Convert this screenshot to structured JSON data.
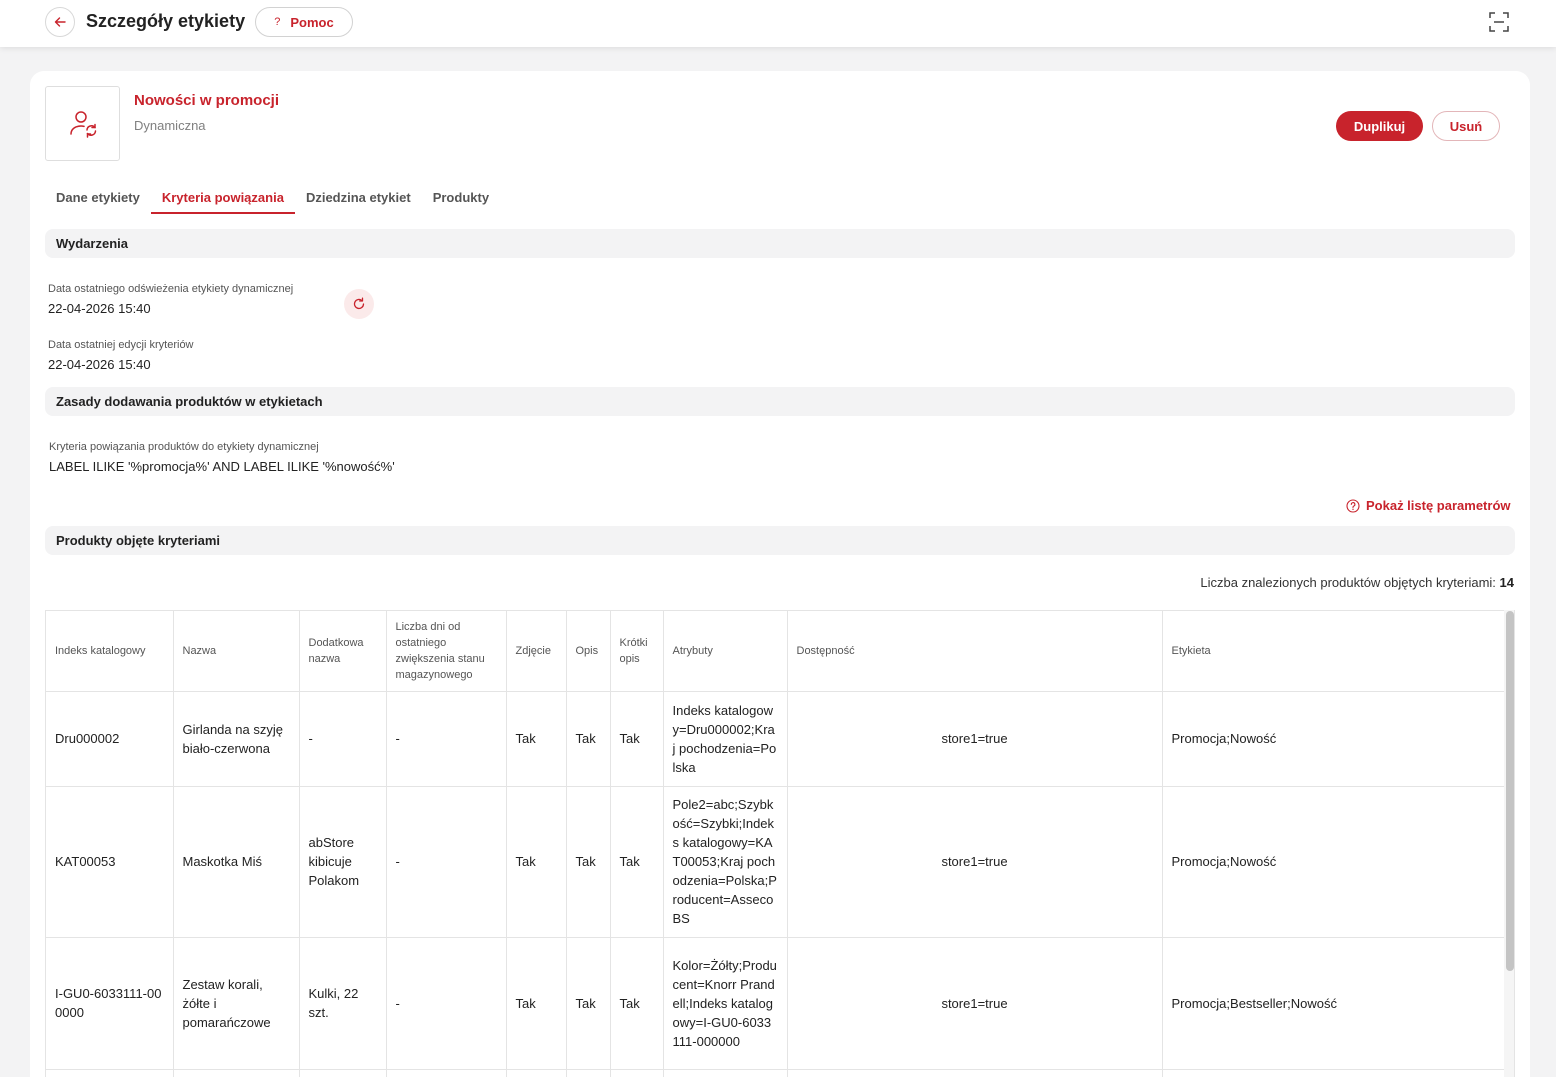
{
  "header": {
    "title": "Szczegóły etykiety",
    "help_label": "Pomoc",
    "help_icon_glyph": "?"
  },
  "label": {
    "name": "Nowości w promocji",
    "type": "Dynamiczna"
  },
  "actions": {
    "duplicate": "Duplikuj",
    "delete": "Usuń"
  },
  "tabs": [
    {
      "label": "Dane etykiety",
      "active": false
    },
    {
      "label": "Kryteria powiązania",
      "active": true
    },
    {
      "label": "Dziedzina etykiet",
      "active": false
    },
    {
      "label": "Produkty",
      "active": false
    }
  ],
  "events": {
    "section_title": "Wydarzenia",
    "refresh_label": "Data ostatniego odświeżenia etykiety dynamicznej",
    "refresh_value": "22-04-2026 15:40",
    "edit_label": "Data ostatniej edycji kryteriów",
    "edit_value": "22-04-2026 15:40"
  },
  "rules": {
    "section_title": "Zasady dodawania produktów w etykietach",
    "criteria_label": "Kryteria powiązania produktów do etykiety dynamicznej",
    "criteria_value": "LABEL ILIKE '%promocja%' AND LABEL ILIKE '%nowość%'",
    "params_link": "Pokaż listę parametrów"
  },
  "products": {
    "section_title": "Produkty objęte kryteriami",
    "count_label": "Liczba znalezionych produktów objętych kryteriami:",
    "count_value": "14",
    "columns": [
      "Indeks katalogowy",
      "Nazwa",
      "Dodatkowa nazwa",
      "Liczba dni od ostatniego zwiększenia stanu magazynowego",
      "Zdjęcie",
      "Opis",
      "Krótki opis",
      "Atrybuty",
      "Dostępność",
      "Etykieta"
    ],
    "rows": [
      {
        "index": "Dru000002",
        "name": "Girlanda na szyję biało-czerwona",
        "extra": "-",
        "days": "-",
        "photo": "Tak",
        "desc": "Tak",
        "short": "Tak",
        "attrs": "Indeks katalogowy=Dru000002;Kraj pochodzenia=Polska",
        "avail": "store1=true",
        "label": "Promocja;Nowość"
      },
      {
        "index": "KAT00053",
        "name": "Maskotka Miś",
        "extra": "abStore kibicuje Polakom",
        "days": "-",
        "photo": "Tak",
        "desc": "Tak",
        "short": "Tak",
        "attrs": "Pole2=abc;Szybkość=Szybki;Indeks katalogowy=KAT00053;Kraj pochodzenia=Polska;Producent=AssecoBS",
        "avail": "store1=true",
        "label": "Promocja;Nowość"
      },
      {
        "index": "I-GU0-6033111-000000",
        "name": "Zestaw korali, żółte i pomarańczowe",
        "extra": "Kulki, 22 szt.",
        "days": "-",
        "photo": "Tak",
        "desc": "Tak",
        "short": "Tak",
        "attrs": "Kolor=Żółty;Producent=Knorr Prandell;Indeks katalogowy=I-GU0-6033111-000000",
        "avail": "store1=true",
        "label": "Promocja;Bestseller;Nowość"
      },
      {
        "index": "",
        "name": "",
        "extra": "",
        "days": "",
        "photo": "",
        "desc": "",
        "short": "",
        "attrs": "",
        "avail": "",
        "label": ""
      }
    ]
  }
}
